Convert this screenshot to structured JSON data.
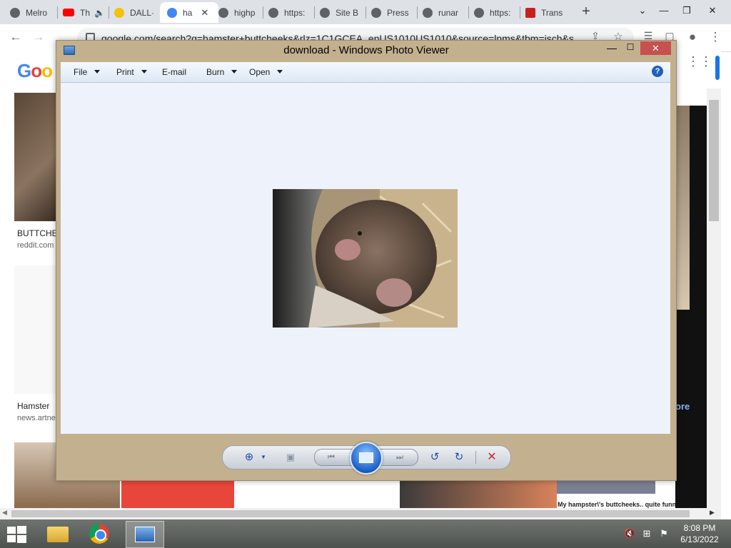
{
  "browser": {
    "tabs": [
      {
        "label": "Melro",
        "icon": "globe-icon"
      },
      {
        "label": "Th",
        "icon": "youtube-icon"
      },
      {
        "label": "DALL·",
        "icon": "emoji-icon"
      },
      {
        "label": "ha",
        "icon": "google-icon"
      },
      {
        "label": "highp",
        "icon": "globe-icon"
      },
      {
        "label": "https:",
        "icon": "globe-icon"
      },
      {
        "label": "Site B",
        "icon": "globe-icon"
      },
      {
        "label": "Press",
        "icon": "globe-icon"
      },
      {
        "label": "runar",
        "icon": "globe-icon"
      },
      {
        "label": "https:",
        "icon": "globe-icon"
      },
      {
        "label": "Trans",
        "icon": "translate-icon"
      }
    ],
    "new_tab": "+",
    "url": "google.com/search?q=hamster+buttcheeks&rlz=1C1GCEA_enUS1010US1010&source=lnms&tbm=isch&s"
  },
  "google": {
    "logo": "Goo",
    "results": [
      {
        "caption": "BUTTCHE",
        "source": "reddit.com"
      },
      {
        "caption": "Hamster",
        "source": "news.artne"
      },
      {
        "caption": "My hampster\\'s buttcheeks.. quite funny",
        "source": ""
      }
    ],
    "more_label": "ore"
  },
  "viewer": {
    "title": "download - Windows Photo Viewer",
    "menu": {
      "file": "File",
      "print": "Print",
      "email": "E-mail",
      "burn": "Burn",
      "open": "Open"
    },
    "help": "?",
    "close_glyph": "✕",
    "min_glyph": "—",
    "max_glyph": "☐"
  },
  "taskbar": {
    "time": "8:08 PM",
    "date": "6/13/2022"
  },
  "colors": {
    "viewer_frame": "#c2b08f",
    "viewer_canvas": "#eef2fa",
    "close_red": "#c75050",
    "taskbar": "#5e625f"
  }
}
